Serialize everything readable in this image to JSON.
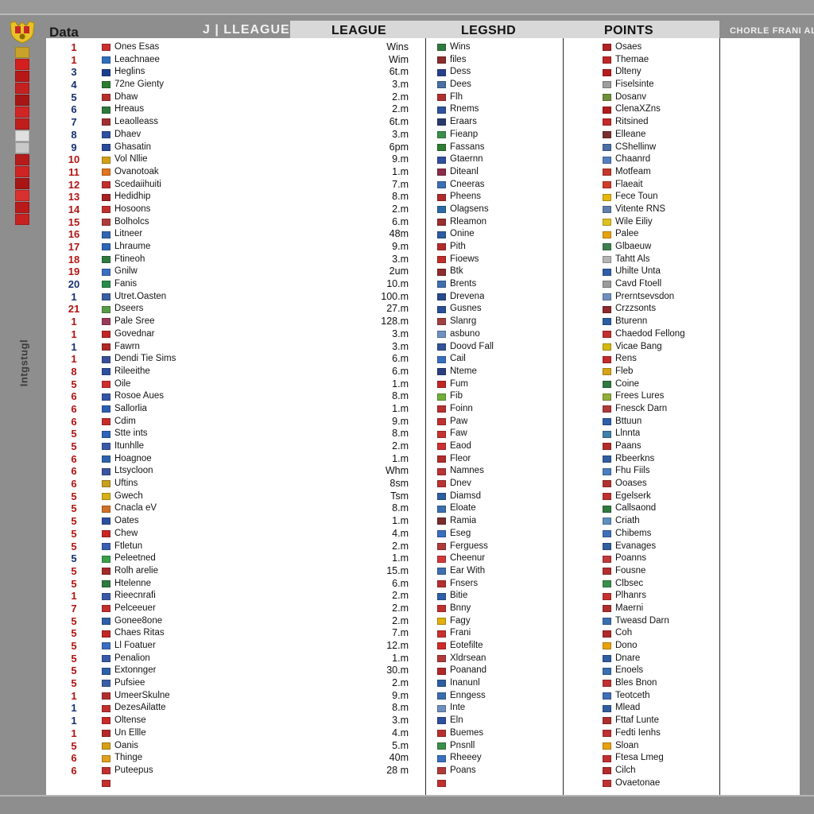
{
  "window": {
    "background_color": "#8e8e8e",
    "sheet_color": "#ffffff"
  },
  "left_rail": {
    "crest_icon": "heraldic-crest-icon",
    "vertical_label": "Intgstugl",
    "badge_colors": [
      "#c9a227",
      "#d41f1f",
      "#b81717",
      "#c42020",
      "#a71616",
      "#d02525",
      "#c01d1d",
      "#e0e0e0",
      "#c8c8c8",
      "#b71c1c",
      "#cf2424",
      "#a81515",
      "#d93030",
      "#bb1a1a",
      "#c62222"
    ]
  },
  "header": {
    "title": "Data",
    "pre_label": "J  |  LLEAGUE",
    "columns": [
      "LEAGUE",
      "LEGSHD",
      "POINTS"
    ],
    "right_label": "CHORLE FRANI AL",
    "band_color": "#d8d8d8"
  },
  "table": {
    "rows": [
      {
        "rank": "1",
        "rank_color": "#b01414",
        "flag": "#c8302f",
        "team": "Ones Esas",
        "league": "Wins",
        "legs_flag": "#2f7a3f",
        "legs": "Wins",
        "points_flag": "#b22222",
        "points": "Osaes"
      },
      {
        "rank": "1",
        "rank_color": "#b01414",
        "flag": "#2f6fbf",
        "team": "Leachnaee",
        "league": "Wim",
        "legs_flag": "#8b2d2d",
        "legs": "files",
        "points_flag": "#c02626",
        "points": "Themae"
      },
      {
        "rank": "3",
        "rank_color": "#17306e",
        "flag": "#1d3f8f",
        "team": "Heglins",
        "league": "6t.m",
        "legs_flag": "#27408b",
        "legs": "Dess",
        "points_flag": "#b71c1c",
        "points": "Dlteny"
      },
      {
        "rank": "4",
        "rank_color": "#17306e",
        "flag": "#2e7d32",
        "team": "72ne Gienty",
        "league": "3.m",
        "legs_flag": "#4a6fa5",
        "legs": "Dees",
        "points_flag": "#9e9e9e",
        "points": "Fiselsinte"
      },
      {
        "rank": "5",
        "rank_color": "#17306e",
        "flag": "#b5302c",
        "team": "Dhaw",
        "league": "2.m",
        "legs_flag": "#b03030",
        "legs": "Flh",
        "points_flag": "#6f8f3a",
        "points": "Dosanv"
      },
      {
        "rank": "6",
        "rank_color": "#17306e",
        "flag": "#2f7a3f",
        "team": "Hreaus",
        "league": "2.m",
        "legs_flag": "#31529e",
        "legs": "Rnems",
        "points_flag": "#b01d1d",
        "points": "ClenaXZns"
      },
      {
        "rank": "7",
        "rank_color": "#17306e",
        "flag": "#a03030",
        "team": "Leaolleass",
        "league": "6t.m",
        "legs_flag": "#2b3a6d",
        "legs": "Eraars",
        "points_flag": "#c42a2a",
        "points": "Ritsined"
      },
      {
        "rank": "8",
        "rank_color": "#17306e",
        "flag": "#3050a0",
        "team": "Dhaev",
        "league": "3.m",
        "legs_flag": "#3c8f4a",
        "legs": "Fieanp",
        "points_flag": "#7a2e2e",
        "points": "Elleane"
      },
      {
        "rank": "9",
        "rank_color": "#17306e",
        "flag": "#2a4a9a",
        "team": "Ghasatin",
        "league": "6pm",
        "legs_flag": "#2e7d32",
        "legs": "Fassans",
        "points_flag": "#4a6fa5",
        "points": "CShellinw"
      },
      {
        "rank": "10",
        "rank_color": "#b01414",
        "flag": "#d4a017",
        "team": "Vol Nllie",
        "league": "9.m",
        "legs_flag": "#2f4f9f",
        "legs": "Gtaernn",
        "points_flag": "#5580c0",
        "points": "Chaanrd"
      },
      {
        "rank": "11",
        "rank_color": "#b01414",
        "flag": "#e0741f",
        "team": "Ovanotoak",
        "league": "1.m",
        "legs_flag": "#8b2d4a",
        "legs": "Diteanl",
        "points_flag": "#c2392b",
        "points": "Motfeam"
      },
      {
        "rank": "12",
        "rank_color": "#b01414",
        "flag": "#c03030",
        "team": "Scedaiihuiti",
        "league": "7.m",
        "legs_flag": "#3b6fb5",
        "legs": "Cneeras",
        "points_flag": "#d03b2a",
        "points": "Flaeait"
      },
      {
        "rank": "13",
        "rank_color": "#b01414",
        "flag": "#a52323",
        "team": "Hedidhip",
        "league": "8.m",
        "legs_flag": "#b02a2a",
        "legs": "Pheens",
        "points_flag": "#e5b80b",
        "points": "Fece Toun"
      },
      {
        "rank": "14",
        "rank_color": "#b01414",
        "flag": "#c22f2f",
        "team": "Hosoons",
        "league": "2.m",
        "legs_flag": "#2d6aa5",
        "legs": "Olagsens",
        "points_flag": "#5f7faf",
        "points": "Vitente RNS"
      },
      {
        "rank": "15",
        "rank_color": "#b01414",
        "flag": "#b03a3a",
        "team": "Bolholcs",
        "league": "6.m",
        "legs_flag": "#9a2f2f",
        "legs": "Rleamon",
        "points_flag": "#e0c020",
        "points": "Wile Eiliy"
      },
      {
        "rank": "16",
        "rank_color": "#b01414",
        "flag": "#3366b0",
        "team": "Litneer",
        "league": "48m",
        "legs_flag": "#2c5ba0",
        "legs": "Onine",
        "points_flag": "#e8a20c",
        "points": "Palee"
      },
      {
        "rank": "17",
        "rank_color": "#b01414",
        "flag": "#2e66b8",
        "team": "Lhraume",
        "league": "9.m",
        "legs_flag": "#b42b2b",
        "legs": "Pith",
        "points_flag": "#3e7f4e",
        "points": "Glbaeuw"
      },
      {
        "rank": "18",
        "rank_color": "#b01414",
        "flag": "#2f7a3f",
        "team": "Ftineoh",
        "league": "3.m",
        "legs_flag": "#c02d2d",
        "legs": "Fioews",
        "points_flag": "#b5b5b5",
        "points": "Tahtt Als"
      },
      {
        "rank": "19",
        "rank_color": "#b01414",
        "flag": "#3c6fc0",
        "team": "Gnilw",
        "league": "2um",
        "legs_flag": "#8e2b2b",
        "legs": "Btk",
        "points_flag": "#2f5fa8",
        "points": "Uhilte Unta"
      },
      {
        "rank": "20",
        "rank_color": "#17306e",
        "flag": "#2a8a4a",
        "team": "Fanis",
        "league": "10.m",
        "legs_flag": "#3f6fb0",
        "legs": "Brents",
        "points_flag": "#9b9b9b",
        "points": "Cavd Ftoell"
      },
      {
        "rank": "1",
        "rank_color": "#17306e",
        "flag": "#3a5fa0",
        "team": "Utret.Oasten",
        "league": "100.m",
        "legs_flag": "#274a8c",
        "legs": "Drevena",
        "points_flag": "#6f8fbf",
        "points": "Prerntsevsdon"
      },
      {
        "rank": "21",
        "rank_color": "#b01414",
        "flag": "#5a9a4a",
        "team": "Dseers",
        "league": "27.m",
        "legs_flag": "#2a4f96",
        "legs": "Gusnes",
        "points_flag": "#8f2a2a",
        "points": "Crzzsonts"
      },
      {
        "rank": "1",
        "rank_color": "#b01414",
        "flag": "#9a3a5a",
        "team": "Pale Sree",
        "league": "128.m",
        "legs_flag": "#a04040",
        "legs": "Slanrg",
        "points_flag": "#2a5fa0",
        "points": "Bturenn"
      },
      {
        "rank": "1",
        "rank_color": "#b01414",
        "flag": "#c02626",
        "team": "Govednar",
        "league": "3.m",
        "legs_flag": "#7090c0",
        "legs": "asbuno",
        "points_flag": "#c22f2f",
        "points": "Chaedod Fellong"
      },
      {
        "rank": "1",
        "rank_color": "#17306e",
        "flag": "#b02828",
        "team": "Fawrn",
        "league": "3.m",
        "legs_flag": "#33529a",
        "legs": "Doovd Fall",
        "points_flag": "#d4b90e",
        "points": "Vicae Bang"
      },
      {
        "rank": "1",
        "rank_color": "#b01414",
        "flag": "#3a4f9a",
        "team": "Dendi Tie Sims",
        "league": "6.m",
        "legs_flag": "#3a6fbf",
        "legs": "Cail",
        "points_flag": "#c52a2a",
        "points": "Rens"
      },
      {
        "rank": "8",
        "rank_color": "#b01414",
        "flag": "#2f4f9f",
        "team": "Rileeithe",
        "league": "6.m",
        "legs_flag": "#2b3f80",
        "legs": "Nteme",
        "points_flag": "#d6a515",
        "points": "Fleb"
      },
      {
        "rank": "5",
        "rank_color": "#b01414",
        "flag": "#cf2e2e",
        "team": "Oile",
        "league": "1.m",
        "legs_flag": "#c02626",
        "legs": "Fum",
        "points_flag": "#2f7a3f",
        "points": "Coine"
      },
      {
        "rank": "6",
        "rank_color": "#b01414",
        "flag": "#3355a5",
        "team": "Rosoe Aues",
        "league": "8.m",
        "legs_flag": "#6fae3a",
        "legs": "Fib",
        "points_flag": "#8fae3a",
        "points": "Frees Lures"
      },
      {
        "rank": "6",
        "rank_color": "#b01414",
        "flag": "#2c5fb0",
        "team": "Sallorlia",
        "league": "1.m",
        "legs_flag": "#b83030",
        "legs": "Foinn",
        "points_flag": "#b03a3a",
        "points": "Fnesck Darn"
      },
      {
        "rank": "6",
        "rank_color": "#b01414",
        "flag": "#c72c2c",
        "team": "Cdim",
        "league": "9.m",
        "legs_flag": "#c02f2f",
        "legs": "Paw",
        "points_flag": "#2e5fa8",
        "points": "Bttuun"
      },
      {
        "rank": "5",
        "rank_color": "#b01414",
        "flag": "#2f63b8",
        "team": "Stte ints",
        "league": "8.m",
        "legs_flag": "#c53232",
        "legs": "Faw",
        "points_flag": "#3f7fa8",
        "points": "Llnnta"
      },
      {
        "rank": "5",
        "rank_color": "#b01414",
        "flag": "#3a5aa8",
        "team": "Itunhlle",
        "league": "2.m",
        "legs_flag": "#cc3030",
        "legs": "Eaod",
        "points_flag": "#b52a2a",
        "points": "Paans"
      },
      {
        "rank": "6",
        "rank_color": "#b01414",
        "flag": "#2d64ae",
        "team": "Hoagnoe",
        "league": "1.m",
        "legs_flag": "#b02d2d",
        "legs": "Fleor",
        "points_flag": "#2f5fa0",
        "points": "Rbeerkns"
      },
      {
        "rank": "6",
        "rank_color": "#b01414",
        "flag": "#3a55a0",
        "team": "Ltsycloon",
        "league": "Whm",
        "legs_flag": "#b93434",
        "legs": "Namnes",
        "points_flag": "#4a7fbf",
        "points": "Fhu Fiils"
      },
      {
        "rank": "6",
        "rank_color": "#b01414",
        "flag": "#c8a020",
        "team": "Uftins",
        "league": "8sm",
        "legs_flag": "#bb3232",
        "legs": "Dnev",
        "points_flag": "#b0302e",
        "points": "Ooases"
      },
      {
        "rank": "5",
        "rank_color": "#b01414",
        "flag": "#d8b01a",
        "team": "Gwech",
        "league": "Tsm",
        "legs_flag": "#2c5fa0",
        "legs": "Diamsd",
        "points_flag": "#c03030",
        "points": "Egelserk"
      },
      {
        "rank": "5",
        "rank_color": "#b01414",
        "flag": "#d07028",
        "team": "Cnacla eV",
        "league": "8.m",
        "legs_flag": "#3b6fae",
        "legs": "Eloate",
        "points_flag": "#2f7a3f",
        "points": "Callsaond"
      },
      {
        "rank": "5",
        "rank_color": "#b01414",
        "flag": "#2f4f9f",
        "team": "Oates",
        "league": "1.m",
        "legs_flag": "#7a2d2d",
        "legs": "Ramia",
        "points_flag": "#5f8fbf",
        "points": "Criath"
      },
      {
        "rank": "5",
        "rank_color": "#b01414",
        "flag": "#c62626",
        "team": "Chew",
        "league": "4.m",
        "legs_flag": "#3a6fbf",
        "legs": "Eseg",
        "points_flag": "#3f6fb8",
        "points": "Chibems"
      },
      {
        "rank": "5",
        "rank_color": "#b01414",
        "flag": "#3a5fb0",
        "team": "Ftletun",
        "league": "2.m",
        "legs_flag": "#b03a3a",
        "legs": "Ferguess",
        "points_flag": "#2f5fa0",
        "points": "Evanages"
      },
      {
        "rank": "5",
        "rank_color": "#17306e",
        "flag": "#3aa04a",
        "team": "Peleetned",
        "league": "1.m",
        "legs_flag": "#d03a3a",
        "legs": "Cheenur",
        "points_flag": "#c03a3a",
        "points": "Poanns"
      },
      {
        "rank": "5",
        "rank_color": "#b01414",
        "flag": "#a52a2a",
        "team": "Rolh arelie",
        "league": "15.m",
        "legs_flag": "#3f6fb0",
        "legs": "Ear With",
        "points_flag": "#b52e2e",
        "points": "Fousne"
      },
      {
        "rank": "5",
        "rank_color": "#b01414",
        "flag": "#2f7a3f",
        "team": "Htelenne",
        "league": "6.m",
        "legs_flag": "#b52f2f",
        "legs": "Fnsers",
        "points_flag": "#3a8f4a",
        "points": "Clbsec"
      },
      {
        "rank": "1",
        "rank_color": "#b01414",
        "flag": "#3a5aa8",
        "team": "Rieecnrafi",
        "league": "2.m",
        "legs_flag": "#2f5fa8",
        "legs": "Bitie",
        "points_flag": "#c83030",
        "points": "Plhanrs"
      },
      {
        "rank": "7",
        "rank_color": "#b01414",
        "flag": "#c23030",
        "team": "Pelceeuer",
        "league": "2.m",
        "legs_flag": "#c03030",
        "legs": "Bnny",
        "points_flag": "#b02d2d",
        "points": "Maerni"
      },
      {
        "rank": "5",
        "rank_color": "#b01414",
        "flag": "#2f5fa8",
        "team": "Gonee8one",
        "league": "2.m",
        "legs_flag": "#e0b010",
        "legs": "Fagy",
        "points_flag": "#3a6fae",
        "points": "Tweasd Darn"
      },
      {
        "rank": "5",
        "rank_color": "#b01414",
        "flag": "#c02626",
        "team": "Chaes Ritas",
        "league": "7.m",
        "legs_flag": "#c83030",
        "legs": "Frani",
        "points_flag": "#b02a2a",
        "points": "Coh"
      },
      {
        "rank": "5",
        "rank_color": "#b01414",
        "flag": "#3a6fbf",
        "team": "Ll Foatuer",
        "league": "12.m",
        "legs_flag": "#d02a2a",
        "legs": "Eotefilte",
        "points_flag": "#e8a20c",
        "points": "Dono"
      },
      {
        "rank": "5",
        "rank_color": "#b01414",
        "flag": "#3a5aa8",
        "team": "Penalion",
        "league": "1.m",
        "legs_flag": "#b03a3a",
        "legs": "Xldrsean",
        "points_flag": "#2f5fa0",
        "points": "Dnare"
      },
      {
        "rank": "5",
        "rank_color": "#b01414",
        "flag": "#2e60a8",
        "team": "Extonnger",
        "league": "30.m",
        "legs_flag": "#b02828",
        "legs": "Poanand",
        "points_flag": "#3a6fb0",
        "points": "Enoels"
      },
      {
        "rank": "5",
        "rank_color": "#b01414",
        "flag": "#3a5fa8",
        "team": "Pufsiee",
        "league": "2.m",
        "legs_flag": "#2f5fa0",
        "legs": "Inanunl",
        "points_flag": "#c03030",
        "points": "Bles Bnon"
      },
      {
        "rank": "1",
        "rank_color": "#b01414",
        "flag": "#b03030",
        "team": "UmeerSkulne",
        "league": "9.m",
        "legs_flag": "#3a6fae",
        "legs": "Enngess",
        "points_flag": "#3f6fb8",
        "points": "Teotceth"
      },
      {
        "rank": "1",
        "rank_color": "#17306e",
        "flag": "#c03030",
        "team": "DezesAilatte",
        "league": "8.m",
        "legs_flag": "#6f8fbf",
        "legs": "Inte",
        "points_flag": "#2f5fa0",
        "points": "Mlead"
      },
      {
        "rank": "1",
        "rank_color": "#17306e",
        "flag": "#c82a2a",
        "team": "Oltense",
        "league": "3.m",
        "legs_flag": "#2f4f9f",
        "legs": "Eln",
        "points_flag": "#b02d2d",
        "points": "Fttaf Lunte"
      },
      {
        "rank": "1",
        "rank_color": "#b01414",
        "flag": "#b52828",
        "team": "Un Ellle",
        "league": "4.m",
        "legs_flag": "#b52f2f",
        "legs": "Buemes",
        "points_flag": "#c03030",
        "points": "Fedti Ienhs"
      },
      {
        "rank": "5",
        "rank_color": "#b01414",
        "flag": "#d4a017",
        "team": "Oanis",
        "league": "5.m",
        "legs_flag": "#3a8f4a",
        "legs": "Pnsnll",
        "points_flag": "#e8a20c",
        "points": "Sloan"
      },
      {
        "rank": "6",
        "rank_color": "#b01414",
        "flag": "#e0a020",
        "team": "Thinge",
        "league": "40m",
        "legs_flag": "#3a6fbf",
        "legs": "Rheeey",
        "points_flag": "#c03030",
        "points": "Ftesa Lmeg"
      },
      {
        "rank": "6",
        "rank_color": "#b01414",
        "flag": "#c03030",
        "team": "Puteepus",
        "league": "28 m",
        "legs_flag": "#b03a3a",
        "legs": "Poans",
        "points_flag": "#b52a2a",
        "points": "Cilch"
      },
      {
        "rank": "",
        "rank_color": "#b01414",
        "flag": "#c03030",
        "team": "",
        "league": "",
        "legs_flag": "#c03030",
        "legs": "",
        "points_flag": "#c03030",
        "points": "Ovaetonae"
      }
    ]
  }
}
